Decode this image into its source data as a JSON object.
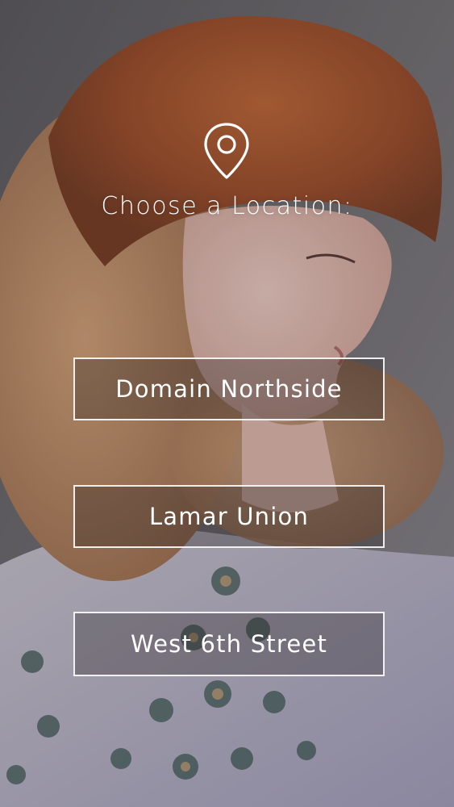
{
  "heading": "Choose a Location:",
  "locations": [
    {
      "label": "Domain Northside"
    },
    {
      "label": "Lamar Union"
    },
    {
      "label": "West 6th Street"
    }
  ],
  "icons": {
    "location": "map-pin-icon"
  },
  "colors": {
    "text": "#ffffff",
    "button_border": "#ffffff"
  }
}
